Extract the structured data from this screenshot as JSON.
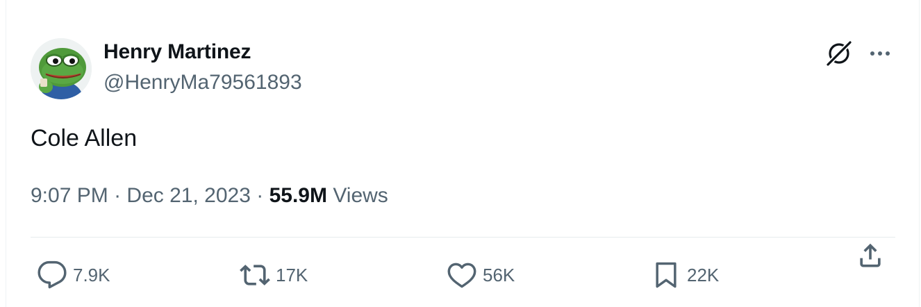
{
  "author": {
    "display_name": "Henry Martinez",
    "handle": "@HenryMa79561893",
    "avatar_icon": "frog-avatar"
  },
  "tweet": {
    "text": "Cole Allen",
    "time": "9:07 PM",
    "separator": "·",
    "date": "Dec 21, 2023",
    "views_count": "55.9M",
    "views_label": "Views"
  },
  "actions": {
    "replies": "7.9K",
    "reposts": "17K",
    "likes": "56K",
    "bookmarks": "22K"
  },
  "icons": {
    "header_right": [
      "grok-icon",
      "more-icon"
    ],
    "actions": [
      "reply-icon",
      "repost-icon",
      "like-icon",
      "bookmark-icon",
      "share-icon"
    ]
  },
  "colors": {
    "text_primary": "#0f1419",
    "text_secondary": "#536471",
    "divider": "#e7ebed"
  }
}
